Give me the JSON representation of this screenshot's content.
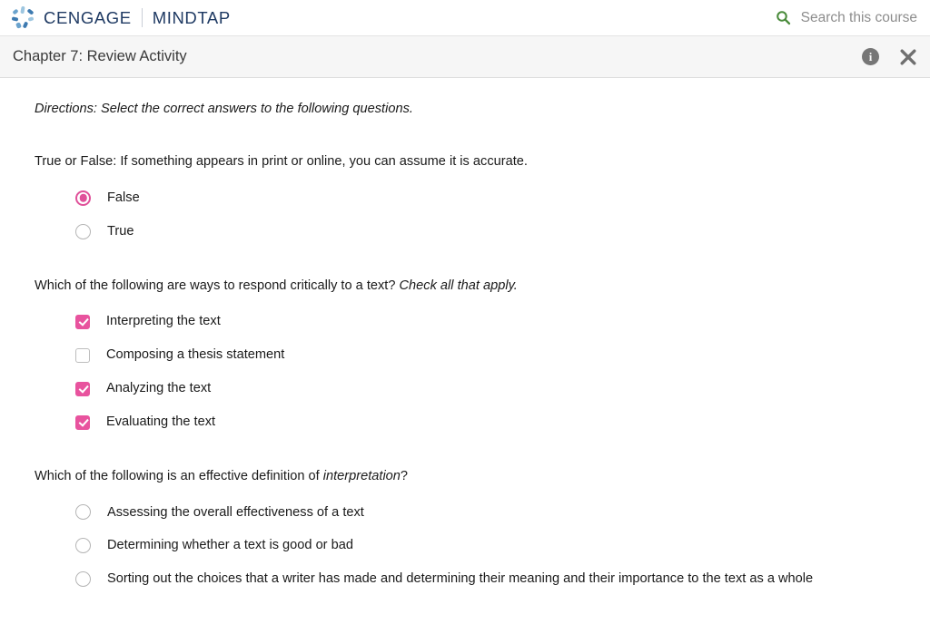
{
  "header": {
    "brand_primary": "CENGAGE",
    "brand_secondary": "MINDTAP",
    "logo_icon": "cengage-petals-icon",
    "search_icon": "search-icon",
    "search_label": "Search this course",
    "search_icon_color": "#4a8b3b"
  },
  "activity_bar": {
    "title": "Chapter 7: Review Activity",
    "info_icon": "info-icon",
    "info_glyph": "i",
    "close_icon": "close-icon"
  },
  "colors": {
    "accent_pink": "#e8539e",
    "brand_navy": "#1f3a63",
    "logo_blue": "#4a86b8",
    "search_green": "#4a8b3b",
    "bar_gray": "#f6f6f6"
  },
  "content": {
    "directions": "Directions: Select the correct answers to the following questions.",
    "questions": [
      {
        "id": "q1",
        "prompt_parts": [
          {
            "text": "True or False: If something appears in print or online, you can assume it is accurate.",
            "italic": false
          }
        ],
        "input_type": "radio",
        "options": [
          {
            "label": "False",
            "checked": true
          },
          {
            "label": "True",
            "checked": false
          }
        ]
      },
      {
        "id": "q2",
        "prompt_parts": [
          {
            "text": "Which of the following are ways to respond critically to a text? ",
            "italic": false
          },
          {
            "text": "Check all that apply.",
            "italic": true
          }
        ],
        "input_type": "checkbox",
        "options": [
          {
            "label": "Interpreting the text",
            "checked": true
          },
          {
            "label": "Composing a thesis statement",
            "checked": false
          },
          {
            "label": "Analyzing the text",
            "checked": true
          },
          {
            "label": "Evaluating the text",
            "checked": true
          }
        ]
      },
      {
        "id": "q3",
        "prompt_parts": [
          {
            "text": "Which of the following is an effective definition of ",
            "italic": false
          },
          {
            "text": "interpretation",
            "italic": true
          },
          {
            "text": "?",
            "italic": false
          }
        ],
        "input_type": "radio",
        "options": [
          {
            "label": "Assessing the overall effectiveness of a text",
            "checked": false
          },
          {
            "label": "Determining whether a text is good or bad",
            "checked": false
          },
          {
            "label": "Sorting out the choices that a writer has made and determining their meaning and their importance to the text as a whole",
            "checked": false
          }
        ]
      }
    ]
  }
}
